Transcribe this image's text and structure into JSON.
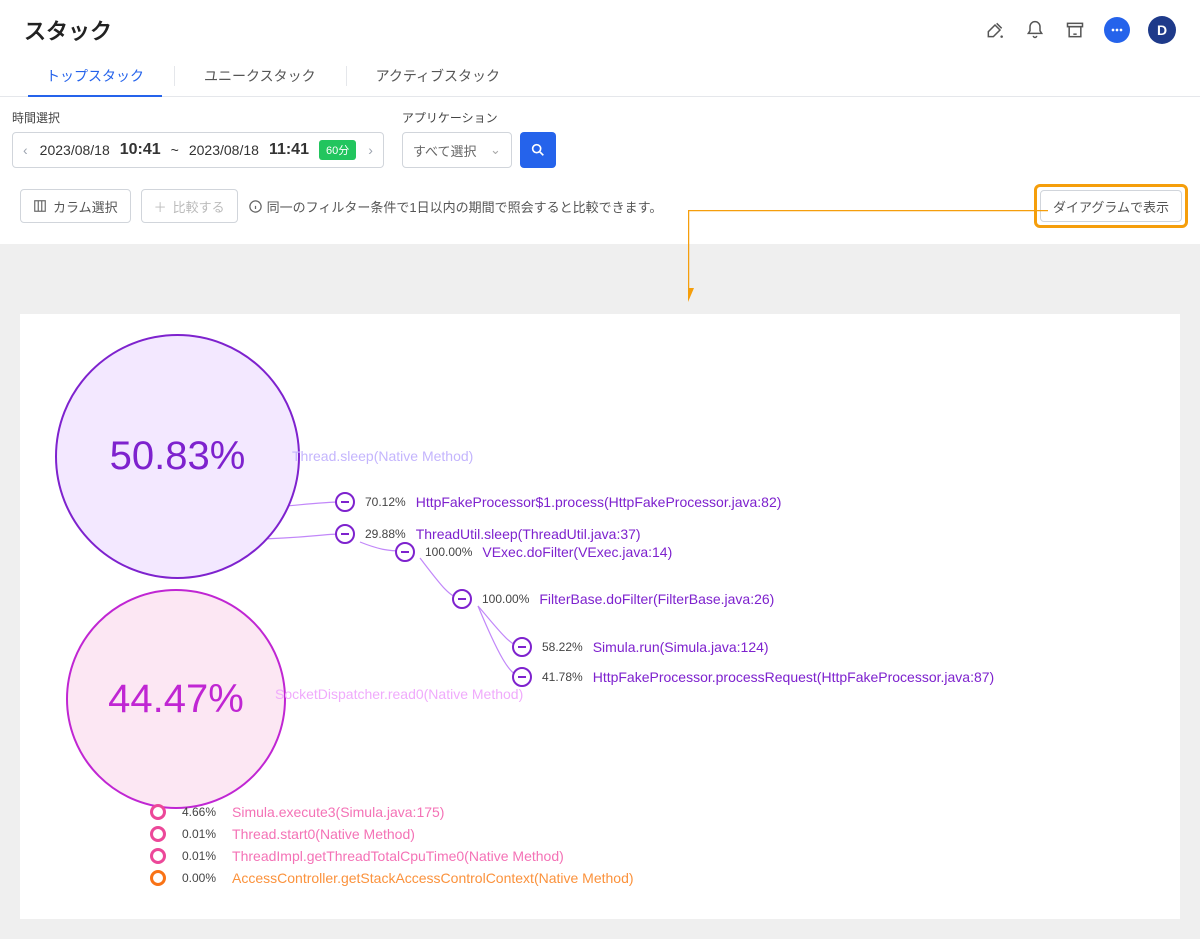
{
  "header": {
    "title": "スタック",
    "avatar_initial": "D"
  },
  "tabs": {
    "items": [
      {
        "label": "トップスタック",
        "active": true
      },
      {
        "label": "ユニークスタック",
        "active": false
      },
      {
        "label": "アクティブスタック",
        "active": false
      }
    ]
  },
  "filters": {
    "time_label": "時間選択",
    "time_from_date": "2023/08/18",
    "time_from_time": "10:41",
    "time_sep": "~",
    "time_to_date": "2023/08/18",
    "time_to_time": "11:41",
    "time_pill": "60分",
    "app_label": "アプリケーション",
    "app_placeholder": "すべて選択"
  },
  "actions": {
    "column_select": "カラム選択",
    "compare": "比較する",
    "hint": "同一のフィルター条件で1日以内の期間で照会すると比較できます。",
    "diagram_view": "ダイアグラムで表示"
  },
  "chart_data": {
    "type": "tree",
    "roots": [
      {
        "id": "thread-sleep",
        "percent": "50.83%",
        "label": "Thread.sleep(Native Method)",
        "color": "purple",
        "children": [
          {
            "percent": "70.12%",
            "label": "HttpFakeProcessor$1.process(HttpFakeProcessor.java:82)"
          },
          {
            "percent": "29.88%",
            "label": "ThreadUtil.sleep(ThreadUtil.java:37)",
            "children": [
              {
                "percent": "100.00%",
                "label": "VExec.doFilter(VExec.java:14)",
                "children": [
                  {
                    "percent": "100.00%",
                    "label": "FilterBase.doFilter(FilterBase.java:26)",
                    "children": [
                      {
                        "percent": "58.22%",
                        "label": "Simula.run(Simula.java:124)"
                      },
                      {
                        "percent": "41.78%",
                        "label": "HttpFakeProcessor.processRequest(HttpFakeProcessor.java:87)"
                      }
                    ]
                  }
                ]
              }
            ]
          }
        ]
      },
      {
        "id": "socket-dispatcher",
        "percent": "44.47%",
        "label": "SocketDispatcher.read0(Native Method)",
        "color": "pink"
      }
    ],
    "small_rows": [
      {
        "percent": "4.66%",
        "label": "Simula.execute3(Simula.java:175)",
        "color": "pink"
      },
      {
        "percent": "0.01%",
        "label": "Thread.start0(Native Method)",
        "color": "pink"
      },
      {
        "percent": "0.01%",
        "label": "ThreadImpl.getThreadTotalCpuTime0(Native Method)",
        "color": "pink"
      },
      {
        "percent": "0.00%",
        "label": "AccessController.getStackAccessControlContext(Native Method)",
        "color": "orange"
      }
    ]
  }
}
